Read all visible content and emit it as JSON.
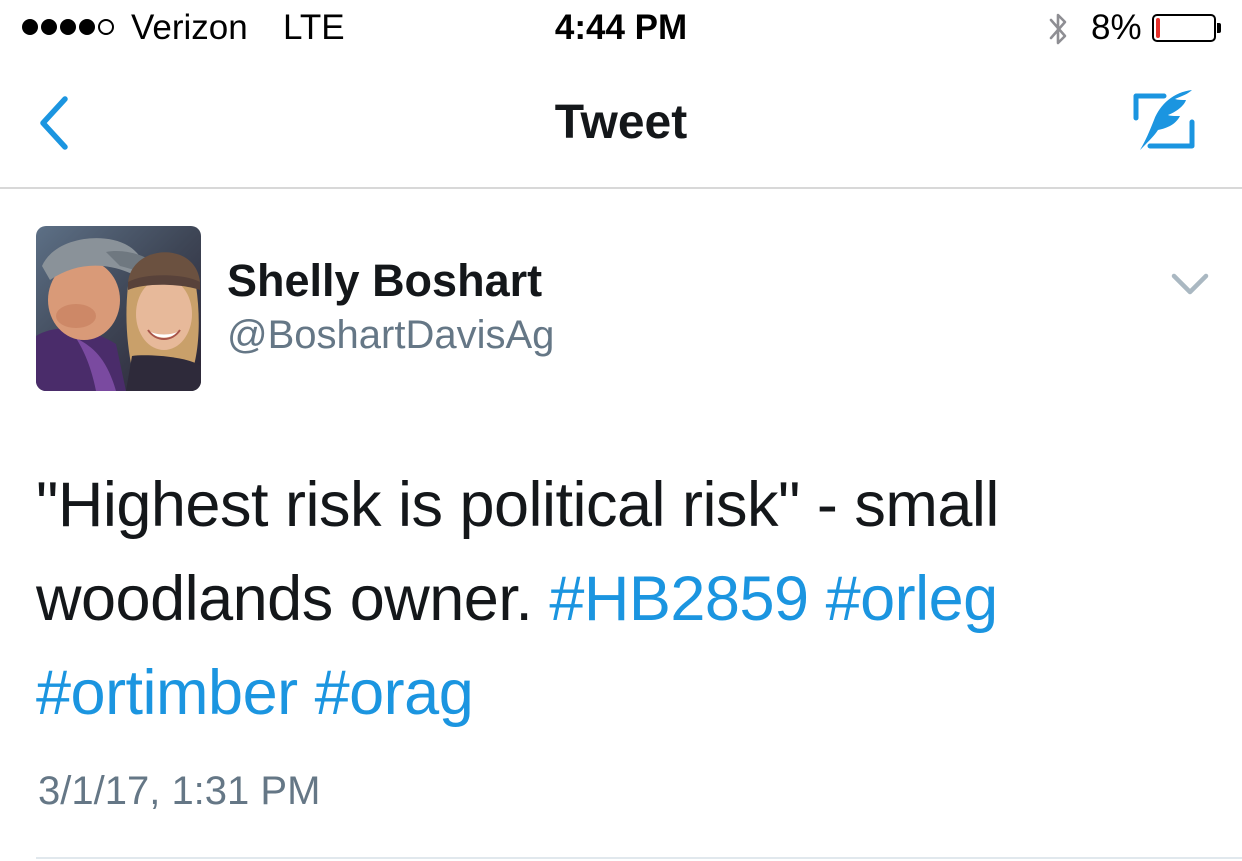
{
  "status_bar": {
    "carrier": "Verizon",
    "network": "LTE",
    "time": "4:44 PM",
    "battery_percent": "8%",
    "signal_bars_filled": 4,
    "signal_bars_total": 5,
    "battery_level_fraction": 0.08,
    "battery_color": "#e6302b",
    "icons": [
      "bluetooth-icon",
      "battery-icon"
    ]
  },
  "nav": {
    "title": "Tweet",
    "back_icon": "chevron-left-icon",
    "compose_icon": "compose-tweet-icon",
    "accent_color": "#1b95e0"
  },
  "tweet": {
    "author_name": "Shelly Boshart",
    "author_handle": "@BoshartDavisAg",
    "text_plain": "\"Highest risk is political risk\" - small woodlands owner. ",
    "hashtags": [
      "#HB2859",
      "#orleg",
      "#ortimber",
      "#orag"
    ],
    "timestamp": "3/1/17, 1:31 PM",
    "menu_icon": "chevron-down-icon"
  }
}
